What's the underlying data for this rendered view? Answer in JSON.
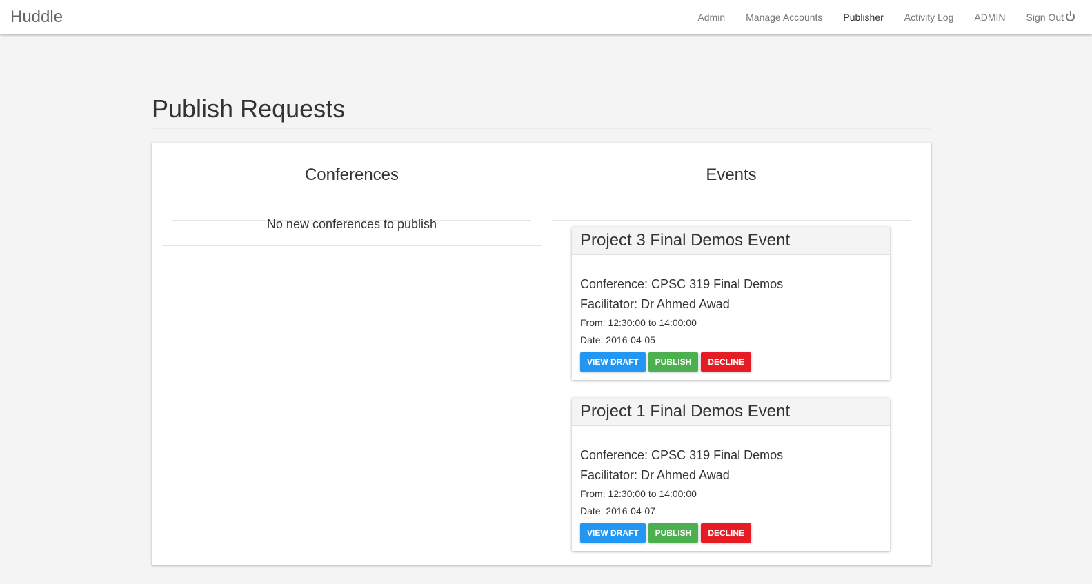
{
  "nav": {
    "brand": "Huddle",
    "links": [
      "Admin",
      "Manage Accounts",
      "Publisher",
      "Activity Log",
      "ADMIN",
      "Sign Out"
    ]
  },
  "page": {
    "title": "Publish Requests"
  },
  "conferences": {
    "heading": "Conferences",
    "empty": "No new conferences to publish"
  },
  "events": {
    "heading": "Events",
    "items": [
      {
        "title": "Project 3 Final Demos Event",
        "conference": "Conference: CPSC 319 Final Demos",
        "facilitator": "Facilitator: Dr Ahmed Awad",
        "time": "From: 12:30:00 to 14:00:00",
        "date": "Date: 2016-04-05"
      },
      {
        "title": "Project 1 Final Demos Event",
        "conference": "Conference: CPSC 319 Final Demos",
        "facilitator": "Facilitator: Dr Ahmed Awad",
        "time": "From: 12:30:00 to 14:00:00",
        "date": "Date: 2016-04-07"
      }
    ]
  },
  "buttons": {
    "view": "VIEW DRAFT",
    "publish": "PUBLISH",
    "decline": "DECLINE"
  },
  "colors": {
    "view": "#2196f3",
    "publish": "#4caf50",
    "decline": "#e51c23"
  }
}
